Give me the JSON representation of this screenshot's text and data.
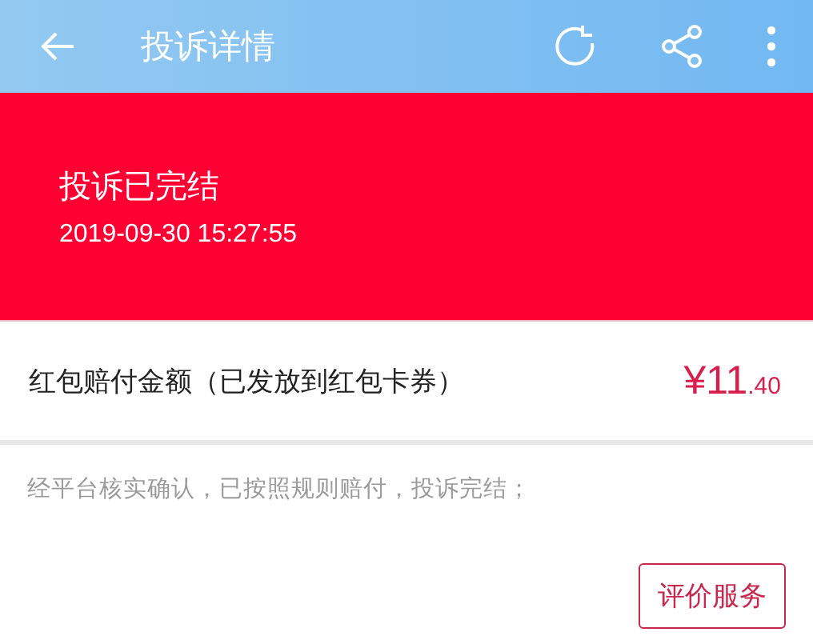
{
  "app_bar": {
    "title": "投诉详情"
  },
  "status_banner": {
    "status": "投诉已完结",
    "time": "2019-09-30 15:27:55"
  },
  "compensation": {
    "label": "红包赔付金额（已发放到红包卡券）",
    "amount_integer": "¥11",
    "amount_decimal": ".40"
  },
  "note": "经平台核实确认，已按照规则赔付，投诉完结；",
  "action_button": "评价服务"
}
